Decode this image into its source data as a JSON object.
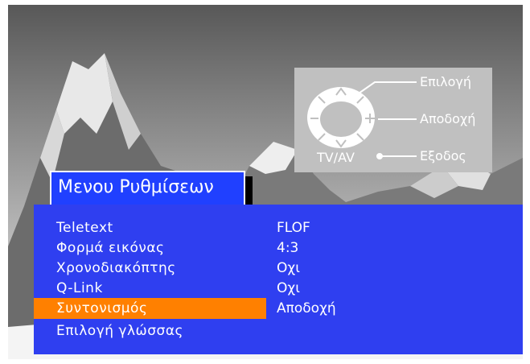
{
  "menu": {
    "title": "Μενου Ρυθμίσεων",
    "items": [
      {
        "label": "Teletext",
        "value": "FLOF",
        "selected": false
      },
      {
        "label": "Φορμά εικόνας",
        "value": "4:3",
        "selected": false
      },
      {
        "label": "Χρονοδιακόπτης",
        "value": "Οχι",
        "selected": false
      },
      {
        "label": "Q-Link",
        "value": "Οχι",
        "selected": false
      },
      {
        "label": "Συντονισμός",
        "value": "Αποδοχή",
        "selected": true
      },
      {
        "label": "Επιλογή γλώσσας",
        "value": "",
        "selected": false
      }
    ]
  },
  "help": {
    "select_label": "Επιλογή",
    "accept_label": "Αποδοχή",
    "exit_label": "Εξοδος",
    "tv_av_label": "TV/AV",
    "up_symbol": "^",
    "down_symbol": "v",
    "minus_symbol": "−",
    "plus_symbol": "+"
  },
  "colors": {
    "menu_background": "#2f3ff0",
    "highlight": "#ff8000",
    "help_panel": "#c0c0c0",
    "text": "#ffffff"
  }
}
